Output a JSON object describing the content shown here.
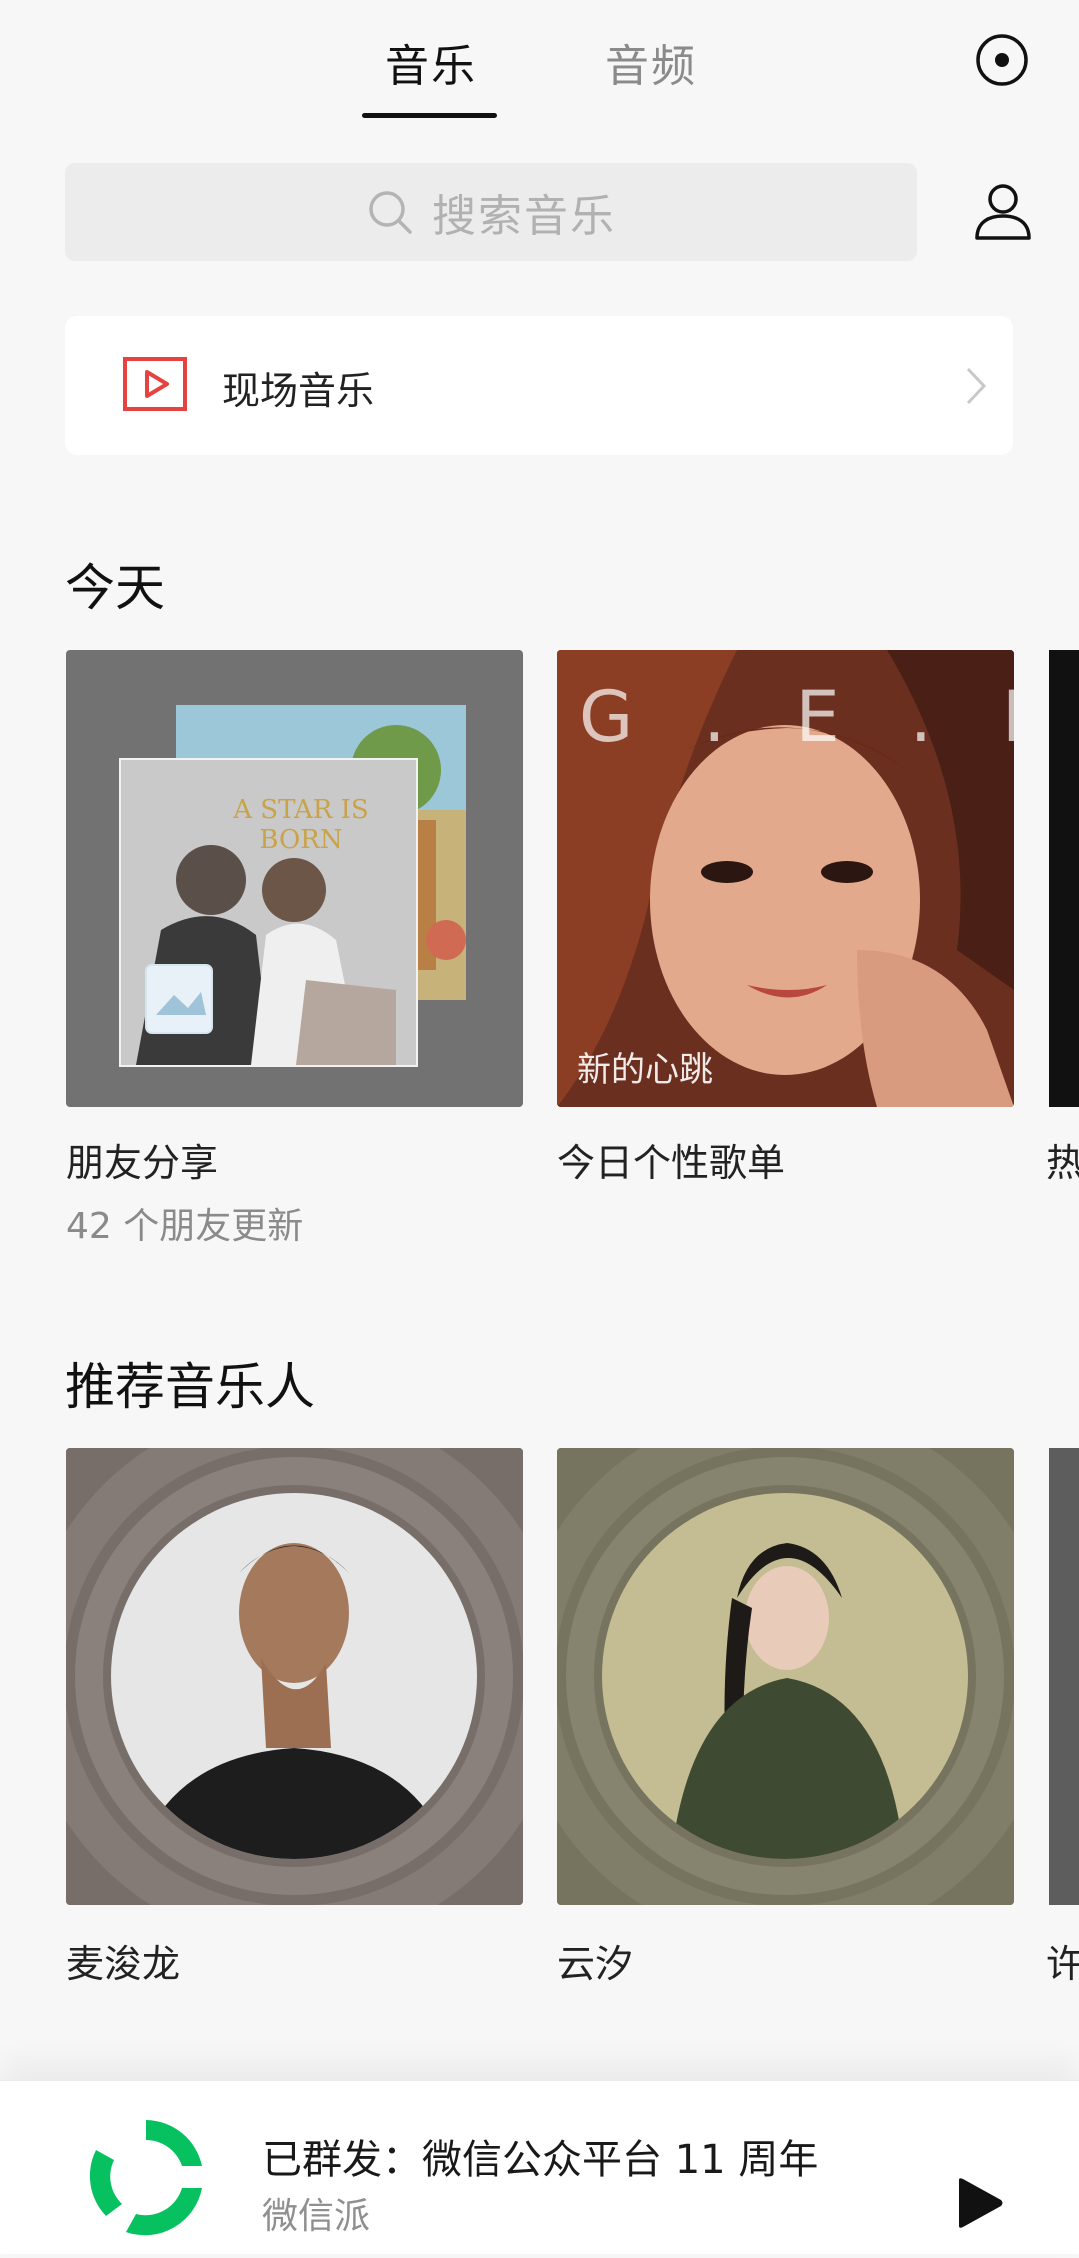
{
  "header": {
    "tabs": [
      {
        "label": "音乐",
        "active": true
      },
      {
        "label": "音频",
        "active": false
      }
    ],
    "radio_icon": "radio-circle-icon"
  },
  "search": {
    "placeholder": "搜索音乐",
    "icon": "search-icon"
  },
  "profile_icon": "user-icon",
  "live_music": {
    "label": "现场音乐",
    "icon": "video-play-icon",
    "accent": "#e64340"
  },
  "today": {
    "title": "今天",
    "items": [
      {
        "title": "朋友分享",
        "subtitle": "42 个朋友更新",
        "cover_text": "A STAR IS BORN"
      },
      {
        "title": "今日个性歌单",
        "subtitle": "",
        "cover_text": "G.E.M.",
        "cover_subtext": "新的心跳"
      },
      {
        "title": "热",
        "subtitle": ""
      }
    ]
  },
  "artists": {
    "title": "推荐音乐人",
    "items": [
      {
        "name": "麦浚龙"
      },
      {
        "name": "云汐"
      },
      {
        "name": "许"
      }
    ]
  },
  "mini_player": {
    "title": "已群发：微信公众平台 11 周年",
    "subtitle": "微信派",
    "play_icon": "play-icon",
    "brand_color": "#07c160"
  }
}
